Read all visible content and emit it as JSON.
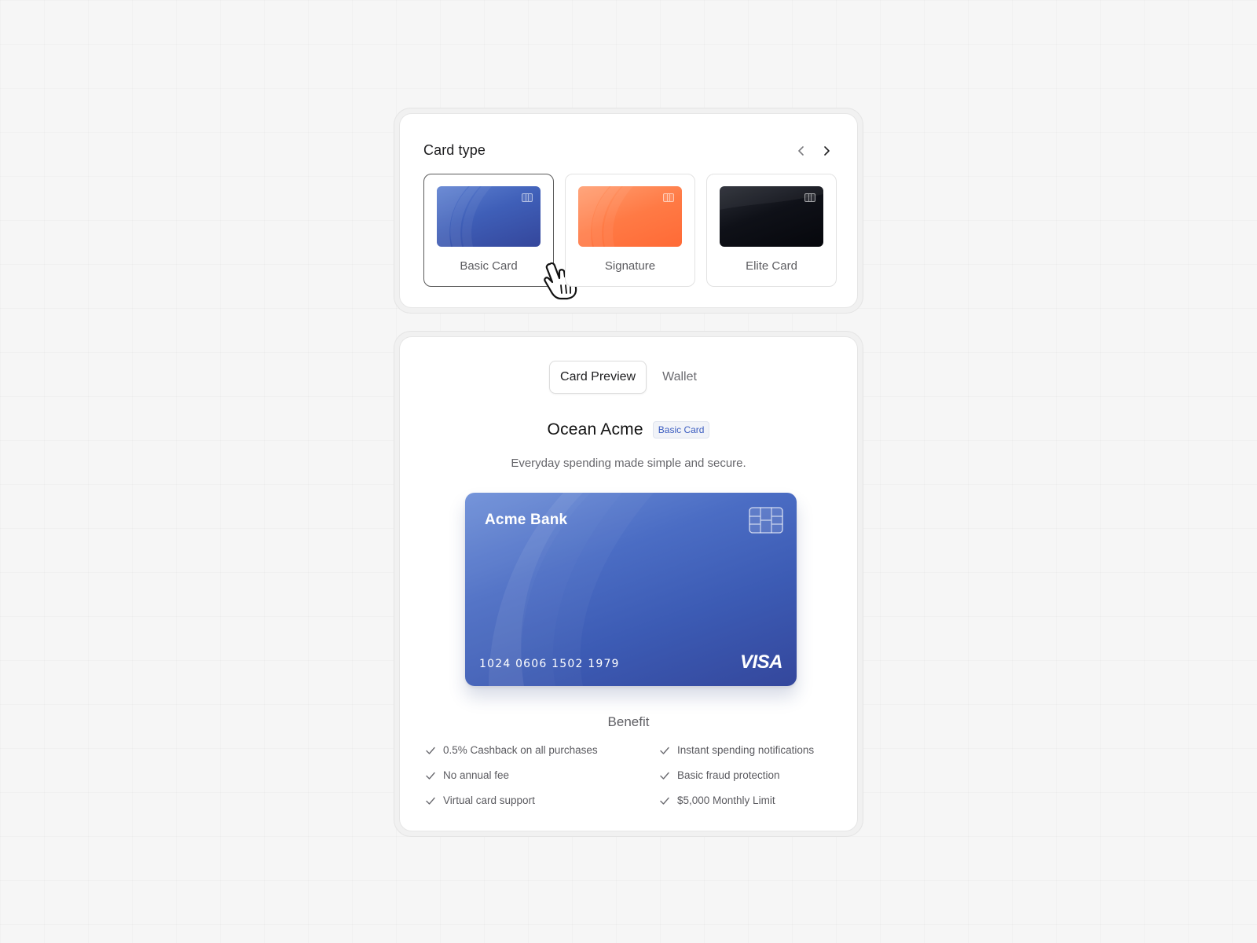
{
  "card_type_panel": {
    "title": "Card type",
    "prev_icon": "chevron-left-icon",
    "next_icon": "chevron-right-icon",
    "options": [
      {
        "label": "Basic Card",
        "theme": "blue",
        "selected": true
      },
      {
        "label": "Signature",
        "theme": "orange",
        "selected": false
      },
      {
        "label": "Elite Card",
        "theme": "black",
        "selected": false
      }
    ]
  },
  "preview_panel": {
    "tabs": [
      {
        "label": "Card Preview",
        "active": true
      },
      {
        "label": "Wallet",
        "active": false
      }
    ],
    "product_name": "Ocean Acme",
    "badge": "Basic Card",
    "tagline": "Everyday spending made simple and secure.",
    "card": {
      "bank_name": "Acme Bank",
      "number": "1024 0606 1502 1979",
      "network": "VISA"
    },
    "benefit_title": "Benefit",
    "benefits": [
      "0.5% Cashback on all purchases",
      "Instant spending notifications",
      "No annual fee",
      "Basic fraud protection",
      "Virtual card support",
      "$5,000 Monthly Limit"
    ]
  },
  "colors": {
    "accent_blue": "#3f5fb8",
    "accent_orange": "#ff7a45",
    "elite_black": "#0f1118",
    "badge_text": "#3b5cc0"
  }
}
